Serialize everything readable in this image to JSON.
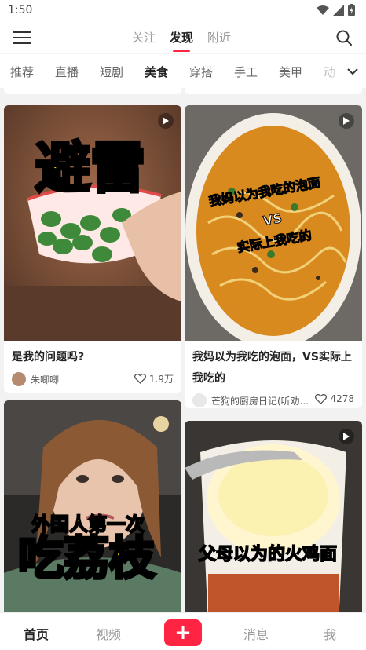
{
  "status_bar": {
    "time": "1:50"
  },
  "top_nav": {
    "tabs": [
      {
        "label": "关注"
      },
      {
        "label": "发现"
      },
      {
        "label": "附近"
      }
    ],
    "active_tab": "发现"
  },
  "categories": {
    "items": [
      "推荐",
      "直播",
      "短剧",
      "美食",
      "穿搭",
      "手工",
      "美甲",
      "动"
    ],
    "active": "美食"
  },
  "feed": {
    "cards": [
      {
        "overlay": "避雷",
        "title": "是我的问题吗?",
        "author": "朱唧唧",
        "likes": "1.9万",
        "is_video": true
      },
      {
        "overlay_line1": "我妈以为我吃的泡面",
        "overlay_line2": "VS",
        "overlay_line3": "实际上我吃的",
        "title": "我妈以为我吃的泡面，VS实际上我吃的",
        "author": "芒狗的厨房日记(听劝...",
        "likes": "4278",
        "is_video": true
      },
      {
        "overlay_line1": "外国人第一次",
        "overlay_line2": "吃荔枝",
        "is_video": false
      },
      {
        "overlay": "父母以为的火鸡面",
        "is_video": true
      }
    ]
  },
  "bottom_nav": {
    "home": "首页",
    "video": "视频",
    "publish": "+",
    "messages": "消息",
    "me": "我"
  },
  "colors": {
    "accent": "#ff2442",
    "overlay_yellow": "#ffe71a"
  }
}
